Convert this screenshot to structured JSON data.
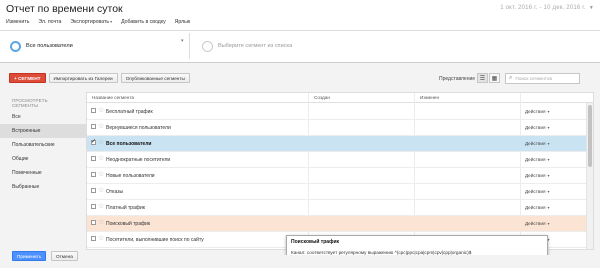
{
  "title": "Отчет по времени суток",
  "date_range": "1 окт. 2016 г. - 10 дек. 2016 г.",
  "menu": {
    "edit": "Изменить",
    "email": "Эл. почта",
    "export": "Экспортировать",
    "add_to_dashboard": "Добавить в сводку",
    "shortcut": "Ярлык"
  },
  "segments": {
    "active": "Все пользователи",
    "placeholder": "Выберите сегмент из списка"
  },
  "toolbar": {
    "new_segment": "+ СЕГМЕНТ",
    "import_gallery": "Импортировать из Галереи",
    "shared_segments": "Опубликованные сегменты"
  },
  "view_label": "Представление",
  "search_placeholder": "Поиск сегментов",
  "left_panel": {
    "header": "ПРОСМОТРЕТЬ СЕГМЕНТЫ",
    "items": [
      "Все",
      "Встроенные",
      "Пользовательские",
      "Общие",
      "Помеченные",
      "Выбранные"
    ],
    "active_index": 1
  },
  "table": {
    "columns": [
      "Название сегмента",
      "Создан",
      "Изменен"
    ],
    "action_label": "Действия",
    "rows": [
      {
        "name": "Бесплатный трафик",
        "checked": false,
        "state": ""
      },
      {
        "name": "Вернувшиеся пользователи",
        "checked": false,
        "state": ""
      },
      {
        "name": "Все пользователи",
        "checked": true,
        "state": "selected"
      },
      {
        "name": "Неоднократные посетители",
        "checked": false,
        "state": ""
      },
      {
        "name": "Новые пользователи",
        "checked": false,
        "state": ""
      },
      {
        "name": "Отказы",
        "checked": false,
        "state": ""
      },
      {
        "name": "Платный трафик",
        "checked": false,
        "state": ""
      },
      {
        "name": "Поисковый трафик",
        "checked": false,
        "state": "hover"
      },
      {
        "name": "Посетители, выполнившие поиск по сайту",
        "checked": false,
        "state": ""
      }
    ]
  },
  "tooltip": {
    "title": "Поисковый трафик",
    "body": "Канал: соответствует регулярному выражению ^(cpc|ppc|cpa|cpm|cpv|cpp|organic)$"
  },
  "footer": {
    "apply": "Применить",
    "cancel": "Отмена"
  }
}
